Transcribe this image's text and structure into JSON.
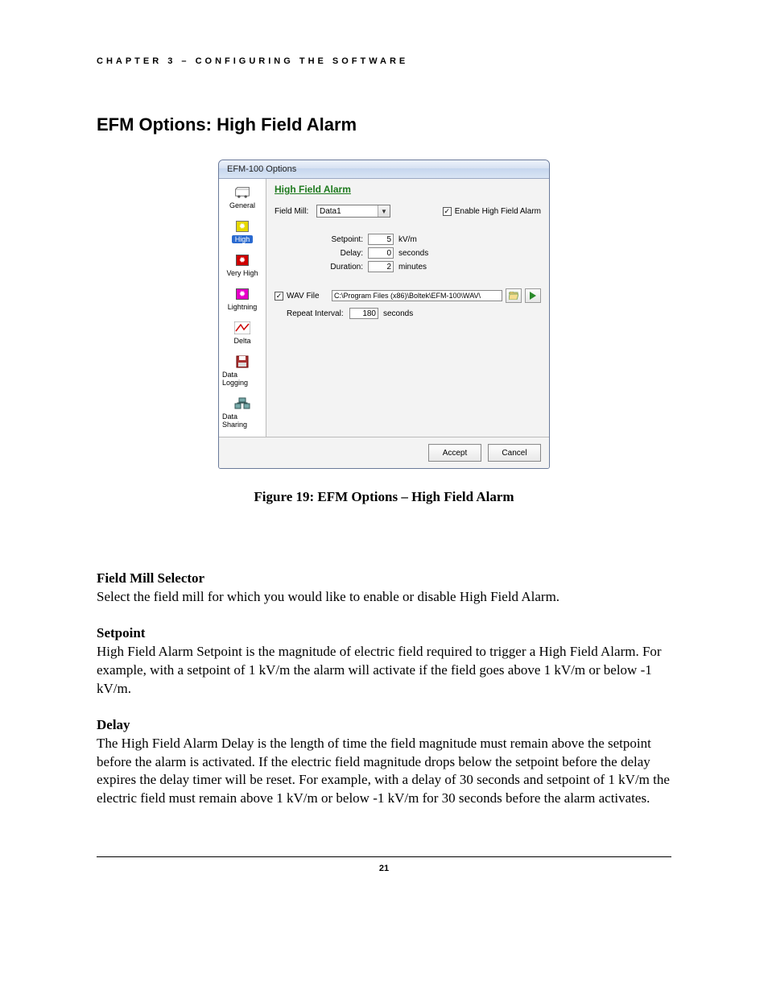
{
  "header": "CHAPTER 3 – CONFIGURING THE SOFTWARE",
  "section_title": "EFM Options: High Field Alarm",
  "dialog": {
    "title": "EFM-100 Options",
    "panel_title": "High Field Alarm",
    "sidebar": {
      "general": "General",
      "high": "High",
      "very_high": "Very High",
      "lightning": "Lightning",
      "delta": "Delta",
      "data_logging": "Data Logging",
      "data_sharing": "Data Sharing"
    },
    "field_mill_label": "Field Mill:",
    "field_mill_value": "Data1",
    "enable_label": "Enable High Field Alarm",
    "enable_checked": "✓",
    "setpoint_label": "Setpoint:",
    "setpoint_value": "5",
    "setpoint_unit": "kV/m",
    "delay_label": "Delay:",
    "delay_value": "0",
    "delay_unit": "seconds",
    "duration_label": "Duration:",
    "duration_value": "2",
    "duration_unit": "minutes",
    "wav_label": "WAV File",
    "wav_checked": "✓",
    "wav_path": "C:\\Program Files (x86)\\Boltek\\EFM-100\\WAV\\",
    "repeat_label": "Repeat Interval:",
    "repeat_value": "180",
    "repeat_unit": "seconds",
    "accept": "Accept",
    "cancel": "Cancel"
  },
  "figure_caption": "Figure 19:  EFM Options – High Field Alarm",
  "body": {
    "field_mill_h": "Field Mill Selector",
    "field_mill_p": "Select the field mill for which you would like to enable or disable High Field Alarm.",
    "setpoint_h": "Setpoint",
    "setpoint_p": "High Field Alarm Setpoint is the magnitude of electric field required to trigger a High Field Alarm. For example, with a setpoint of 1 kV/m the alarm will activate if the field goes above 1 kV/m or below -1 kV/m.",
    "delay_h": "Delay",
    "delay_p": "The High Field Alarm Delay is the length of time the field magnitude must remain above the setpoint before the alarm is activated.  If the electric field magnitude drops below the setpoint before the delay expires the delay timer will be reset.  For example, with a delay of 30 seconds and setpoint of 1 kV/m the electric field must remain above 1 kV/m or below -1 kV/m for 30 seconds before the alarm activates."
  },
  "page_number": "21"
}
